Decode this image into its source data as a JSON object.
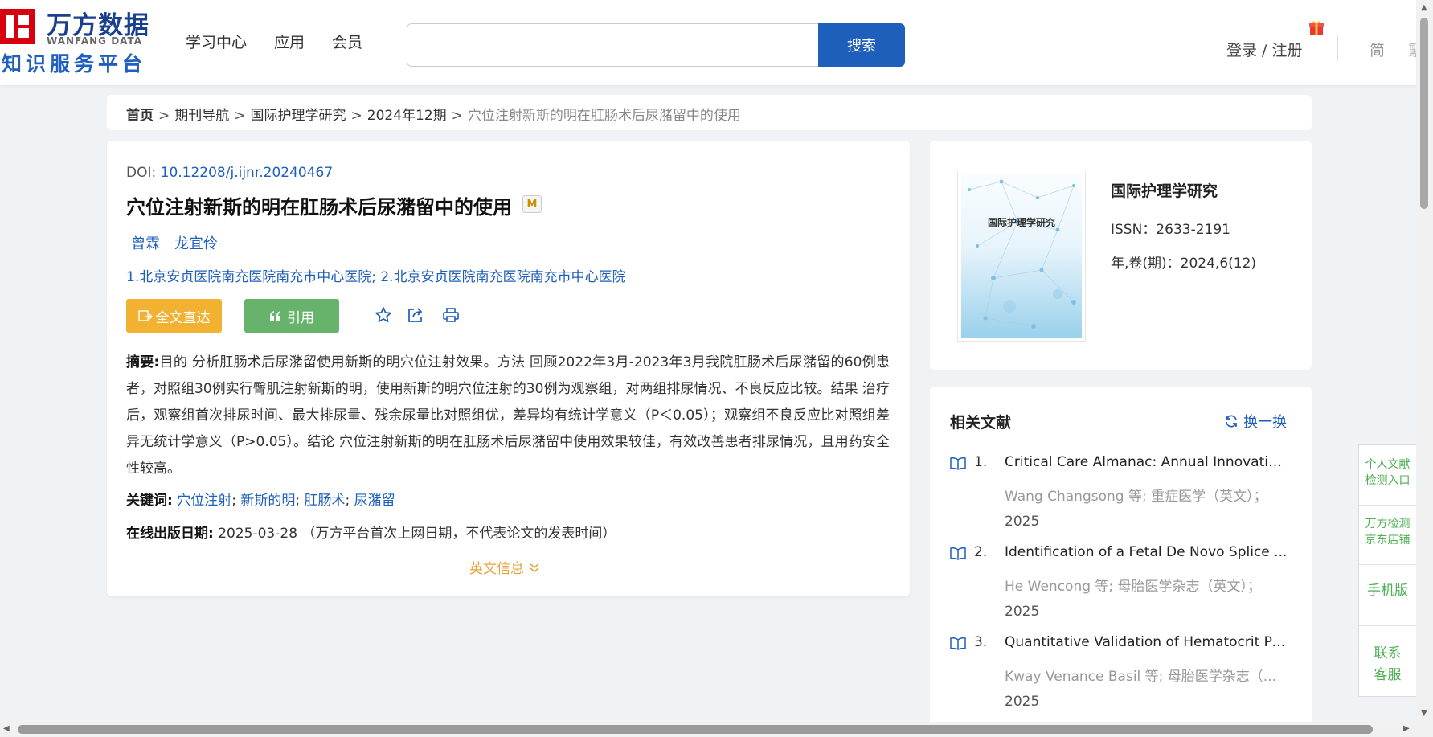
{
  "header": {
    "logo_cn": "万方数据",
    "logo_en": "WANFANG DATA",
    "logo_sub": "知识服务平台",
    "nav": [
      "学习中心",
      "应用",
      "会员"
    ],
    "search_placeholder": "",
    "search_button": "搜索",
    "login": "登录 / 注册",
    "lang_simplified": "简",
    "lang_traditional": "繁"
  },
  "breadcrumb": {
    "home": "首页",
    "items": [
      "期刊导航",
      "国际护理学研究",
      "2024年12期"
    ],
    "current": "穴位注射新斯的明在肛肠术后尿潴留中的使用",
    "separator": ">"
  },
  "article": {
    "doi_label": "DOI:",
    "doi": "10.12208/j.ijnr.20240467",
    "title": "穴位注射新斯的明在肛肠术后尿潴留中的使用",
    "m_badge": "M",
    "authors": [
      "曾霖",
      "龙宜伶"
    ],
    "affiliations": "1.北京安贞医院南充医院南充市中心医院; 2.北京安贞医院南充医院南充市中心医院",
    "btn_fulltext": "全文直达",
    "btn_cite": "引用",
    "abstract_label": "摘要:",
    "abstract": "目的 分析肛肠术后尿潴留使用新斯的明穴位注射效果。方法 回顾2022年3月-2023年3月我院肛肠术后尿潴留的60例患者，对照组30例实行臀肌注射新斯的明，使用新斯的明穴位注射的30例为观察组，对两组排尿情况、不良反应比较。结果 治疗后，观察组首次排尿时间、最大排尿量、残余尿量比对照组优，差异均有统计学意义（P＜0.05）；观察组不良反应比对照组差异无统计学意义（P>0.05）。结论 穴位注射新斯的明在肛肠术后尿潴留中使用效果较佳，有效改善患者排尿情况，且用药安全性较高。",
    "keywords_label": "关键词:",
    "keywords": [
      "穴位注射",
      "新斯的明",
      "肛肠术",
      "尿潴留"
    ],
    "pubdate_label": "在线出版日期:",
    "pubdate": "2025-03-28",
    "pubdate_note": "（万方平台首次上网日期，不代表论文的发表时间）",
    "english_info": "英文信息"
  },
  "journal": {
    "cover_title": "国际护理学研究",
    "name": "国际护理学研究",
    "issn": "ISSN：2633-2191",
    "volume": "年,卷(期)：2024,6(12)"
  },
  "related": {
    "title": "相关文献",
    "switch": "换一换",
    "items": [
      {
        "num": "1.",
        "title": "Critical Care Almanac: Annual Innovation...",
        "meta": "Wang Changsong  等;  重症医学（英文）；",
        "year": "2025"
      },
      {
        "num": "2.",
        "title": "Identification of a Fetal De Novo Splice ...",
        "meta": "He Wencong  等;  母胎医学杂志（英文）；",
        "year": "2025"
      },
      {
        "num": "3.",
        "title": "Quantitative Validation of Hematocrit Pe...",
        "meta": "Kway Venance Basil  等;  母胎医学杂志（...",
        "year": "2025"
      }
    ]
  },
  "float_bar": {
    "item1": [
      "个人文献",
      "检测入口"
    ],
    "item2": [
      "万方检测",
      "京东店铺"
    ],
    "item3": "手机版",
    "item4": [
      "联系",
      "客服"
    ]
  },
  "colors": {
    "brand_blue": "#1e5fbb",
    "brand_red": "#d7000f",
    "fulltext_orange": "#f3b132",
    "cite_green": "#68b36b",
    "float_green": "#4caf50"
  }
}
